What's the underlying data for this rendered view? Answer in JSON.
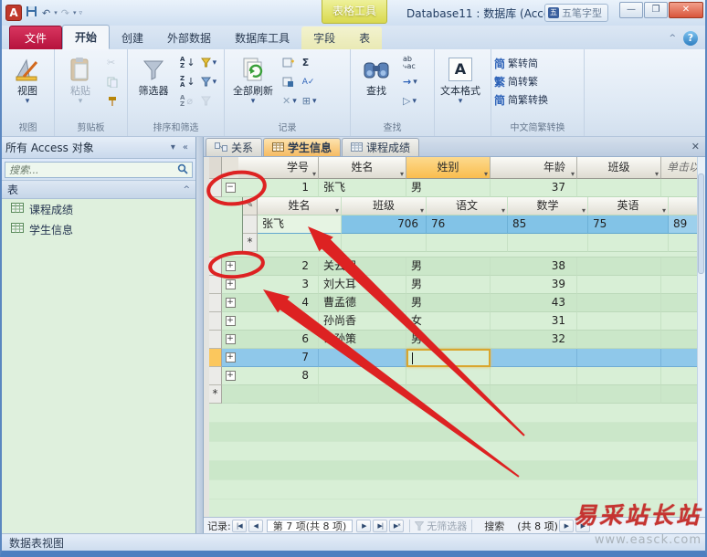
{
  "window": {
    "title": "Database11 : 数据库 (Acce",
    "ime_badge": "五笔字型",
    "contextual_tool": "表格工具",
    "controls": {
      "minimize": "—",
      "maximize": "❐",
      "close": "✕"
    }
  },
  "tabs": {
    "file": "文件",
    "home": "开始",
    "create": "创建",
    "external": "外部数据",
    "dbtools": "数据库工具",
    "fields": "字段",
    "table": "表",
    "active": "开始"
  },
  "ribbon": {
    "groups": {
      "views": {
        "label": "视图",
        "big": "视图"
      },
      "clipboard": {
        "label": "剪贴板",
        "big": "粘贴"
      },
      "sort": {
        "label": "排序和筛选",
        "big": "筛选器"
      },
      "records": {
        "label": "记录",
        "big": "全部刷新"
      },
      "find": {
        "label": "查找",
        "big": "查找"
      },
      "textfmt": {
        "label": "",
        "big": "文本格式"
      },
      "chinese": {
        "label": "中文简繁转换",
        "items": [
          "繁转简",
          "简转繁",
          "简繁转换"
        ],
        "item_icons": [
          "简",
          "繁",
          "简"
        ]
      }
    }
  },
  "navpane": {
    "title": "所有 Access 对象",
    "search_placeholder": "搜索...",
    "section": "表",
    "items": [
      "课程成绩",
      "学生信息"
    ]
  },
  "doctabs": {
    "items": [
      "关系",
      "学生信息",
      "课程成绩"
    ],
    "active": "学生信息"
  },
  "datasheet": {
    "columns": {
      "id": "学号",
      "name": "姓名",
      "gender": "姓别",
      "age": "年龄",
      "klass": "班级",
      "add": "单击以添加"
    },
    "rows": [
      {
        "id": "1",
        "name": "张飞",
        "gender": "男",
        "age": "37"
      },
      {
        "id": "2",
        "name": "关云羽",
        "gender": "男",
        "age": "38"
      },
      {
        "id": "3",
        "name": "刘大耳",
        "gender": "男",
        "age": "39"
      },
      {
        "id": "4",
        "name": "曹孟德",
        "gender": "男",
        "age": "43"
      },
      {
        "id": "5",
        "name": "孙尚香",
        "gender": "女",
        "age": "31"
      },
      {
        "id": "6",
        "name": "公孙策",
        "gender": "男",
        "age": "32"
      },
      {
        "id": "7",
        "name": "",
        "gender": "",
        "age": ""
      },
      {
        "id": "8",
        "name": "",
        "gender": "",
        "age": ""
      }
    ],
    "current_row": "7",
    "subdatasheet": {
      "columns": {
        "name": "姓名",
        "klass": "班级",
        "chinese": "语文",
        "math": "数学",
        "english": "英语"
      },
      "row": {
        "name": "张飞",
        "klass": "706",
        "chinese": "76",
        "math": "85",
        "english": "75",
        "extra": "89"
      }
    }
  },
  "recordbar": {
    "label": "记录:",
    "position": "第 7 项(共 8 项)",
    "no_filter": "无筛选器",
    "search": "搜索",
    "overlap_fragment": "(共 8 项)"
  },
  "statusbar": {
    "view_name": "数据表视图"
  },
  "watermark": {
    "line1": "易采站长站",
    "line2": "www.easck.com"
  },
  "icons": {
    "dropdown": "▾",
    "collapse_pane": "«",
    "collapse_section": "^",
    "pane_menu": "▾",
    "scissors": "✂",
    "pencil": "✎",
    "sigma": "Σ",
    "delete_x": "✕",
    "new_star": "*",
    "undo": "↶",
    "redo": "↷",
    "prev": "◀",
    "next": "▶",
    "first": "|◀",
    "last": "▶|",
    "new_record": "▶*",
    "replace": "ab",
    "goto": "→",
    "select": "▷",
    "more_grid": "⊞",
    "spell": "A✓",
    "help": "?",
    "min_ribbon": "^",
    "expand_plus": "+",
    "collapse_minus": "−"
  },
  "colors": {
    "selection_blue": "#8fc8ea",
    "row_green": "#d7eed5",
    "header_highlight": "#f9bd4e",
    "annotation_red": "#dd2222",
    "watermark_red": "#c53431",
    "file_tab_red": "#b6123d",
    "table_tools_yellow": "#d9d94e",
    "current_record_orange": "#fbc75d"
  }
}
